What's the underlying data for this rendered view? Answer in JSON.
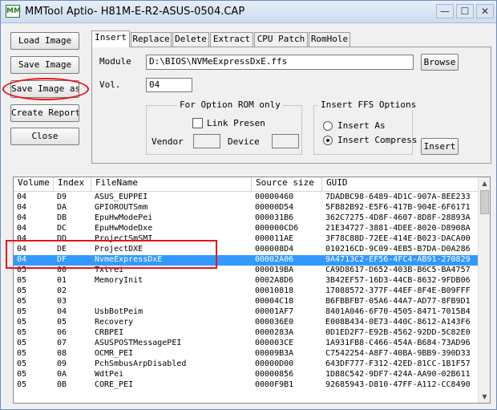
{
  "window": {
    "title": "MMTool Aptio- H81M-E-R2-ASUS-0504.CAP",
    "icon_label": "MM",
    "controls": {
      "minimize": "—",
      "maximize": "☐",
      "close": "✕"
    }
  },
  "sidebar": {
    "load": "Load Image",
    "save": "Save Image",
    "save_as": "Save Image as..",
    "report": "Create Report",
    "close": "Close"
  },
  "tabs": [
    "Insert",
    "Replace",
    "Delete",
    "Extract",
    "CPU Patch",
    "RomHole"
  ],
  "insert": {
    "module_label": "Module",
    "module_path": "D:\\BIOS\\NVMeExpressDxE.ffs",
    "browse": "Browse",
    "vol_label": "Vol.",
    "vol_value": "04",
    "option_rom_title": "For Option ROM only",
    "link_present": "Link Presen",
    "vendor_label": "Vendor",
    "device_label": "Device",
    "ffs_title": "Insert FFS Options",
    "insert_as": "Insert As",
    "insert_compress": "Insert Compress",
    "insert_button": "Insert"
  },
  "table": {
    "columns": [
      "Volume",
      "Index",
      "FileName",
      "Source size",
      "GUID"
    ],
    "rows": [
      [
        "04",
        "D9",
        "ASUS_EUPPEI",
        "00000460",
        "7DADBC98-6489-4D1C-907A-8EE233"
      ],
      [
        "04",
        "DA",
        "GPIOROUTSmm",
        "00000D54",
        "5FB82B92-E5F6-417B-904E-6F6171"
      ],
      [
        "04",
        "DB",
        "EpuHwModePei",
        "000031B6",
        "362C7275-4D8F-4607-8D8F-28893A"
      ],
      [
        "04",
        "DC",
        "EpuHwModeDxe",
        "000000CD6",
        "21E34727-3881-4DEE-8020-D8908A"
      ],
      [
        "04",
        "DD",
        "ProjectSmSMI",
        "000011AE",
        "3F78C88D-72EE-414E-B023-DACA00"
      ],
      [
        "04",
        "DE",
        "ProjectDXE",
        "000008D4",
        "010216CD-9C09-4EB5-B7DA-D0A286"
      ],
      [
        "04",
        "DF",
        "NvmeExpressDxE",
        "00002A06",
        "9A4713C2-EF56-4FC4-AB91-270829"
      ],
      [
        "05",
        "00",
        "Txtrei",
        "000019BA",
        "CA9D8617-D652-403B-B6C5-BA4757"
      ],
      [
        "05",
        "01",
        "MemoryInit",
        "0002A8D6",
        "3B42EF57-16D3-44CB-8632-9FDB06"
      ],
      [
        "05",
        "02",
        "",
        "00010818",
        "17088572-377F-44EF-8F4E-B09FFF"
      ],
      [
        "05",
        "03",
        "",
        "00004C18",
        "B6FBBFB7-05A6-44A7-AD77-8FB9D1"
      ],
      [
        "05",
        "04",
        "UsbBotPeim",
        "00001AF7",
        "8401A046-6F70-4505-8471-7015B4"
      ],
      [
        "05",
        "05",
        "Recovery",
        "000036E0",
        "E008B434-0E73-440C-8612-A143F6"
      ],
      [
        "05",
        "06",
        "CRBPEI",
        "0000283A",
        "0D1ED2F7-E92B-4562-92DD-5C82E0"
      ],
      [
        "05",
        "07",
        "ASUSPOSTMessagePEI",
        "000003CE",
        "1A931FB8-C466-454A-B684-73AD96"
      ],
      [
        "05",
        "08",
        "OCMR_PEI",
        "00009B3A",
        "C7542254-A8F7-40BA-9BB9-390D33"
      ],
      [
        "05",
        "09",
        "PchSmbusArpDisabled",
        "00000D00",
        "643DF777-F312-42ED-81CC-1B1F57"
      ],
      [
        "05",
        "0A",
        "WdtPei",
        "00000856",
        "1D88C542-9DF7-424A-AA90-02B611"
      ],
      [
        "05",
        "0B",
        "CORE_PEI",
        "0000F9B1",
        "92685943-D810-47FF-A112-CC8490"
      ]
    ],
    "selected_row": 6
  },
  "colors": {
    "selection": "#3399ff",
    "annotation": "#e8141a"
  }
}
